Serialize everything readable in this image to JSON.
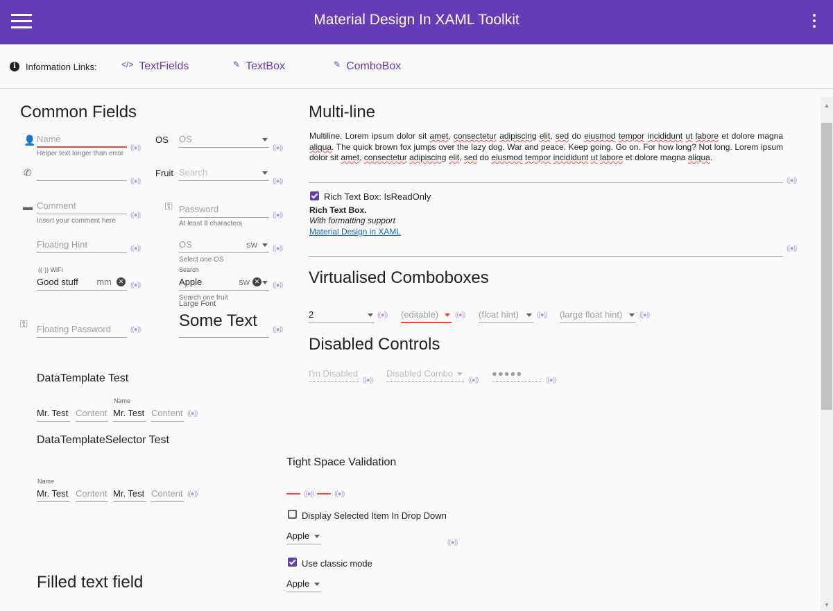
{
  "app": {
    "title": "Material Design In XAML Toolkit"
  },
  "info": {
    "label": "Information Links:",
    "links": [
      {
        "label": "TextFields",
        "icon": "code-icon"
      },
      {
        "label": "TextBox",
        "icon": "pencil-icon"
      },
      {
        "label": "ComboBox",
        "icon": "pencil-icon"
      }
    ]
  },
  "common": {
    "heading": "Common Fields",
    "name": {
      "hint": "Name",
      "helper": "Helper text longer than error"
    },
    "phone": {
      "hint": ""
    },
    "comment": {
      "hint": "Comment",
      "helper": "Insert your comment here"
    },
    "floating_hint": "Floating Hint",
    "wifi": {
      "label": "WiFi",
      "value": "Good stuff",
      "suffix": "mm"
    },
    "floating_password": "Floating Password",
    "os": {
      "label": "OS",
      "hint": "OS"
    },
    "fruit": {
      "label": "Fruit",
      "hint": "Search"
    },
    "password": {
      "hint": "Password",
      "helper": "At least 8 characters"
    },
    "os2": {
      "hint": "OS",
      "suffix": "sw",
      "helper": "Select one OS"
    },
    "search": {
      "label": "Search",
      "value": "Apple",
      "suffix": "sw",
      "helper": "Search one fruit"
    },
    "large_font": {
      "label": "Large Font",
      "value": "Some Text"
    }
  },
  "datatemplate": {
    "title": "DataTemplate Test",
    "name_label": "Name",
    "cells": [
      "Mr. Test",
      "Content",
      "Mr. Test",
      "Content"
    ]
  },
  "selector": {
    "title": "DataTemplateSelector Test",
    "name_label": "Name",
    "cells": [
      "Mr. Test",
      "Content",
      "Mr. Test",
      "Content"
    ]
  },
  "filled": {
    "heading": "Filled text field"
  },
  "multiline": {
    "heading": "Multi-line",
    "text_parts": [
      [
        "Multiline. Lorem ipsum dolor sit ",
        false
      ],
      [
        "amet",
        true
      ],
      [
        ", ",
        false
      ],
      [
        "consectetur",
        true
      ],
      [
        " ",
        false
      ],
      [
        "adipiscing",
        true
      ],
      [
        " ",
        false
      ],
      [
        "elit",
        true
      ],
      [
        ", ",
        false
      ],
      [
        "sed",
        true
      ],
      [
        " do ",
        false
      ],
      [
        "eiusmod",
        true
      ],
      [
        " ",
        false
      ],
      [
        "tempor",
        true
      ],
      [
        " ",
        false
      ],
      [
        "incididunt",
        true
      ],
      [
        " ",
        false
      ],
      [
        "ut",
        true
      ],
      [
        " ",
        false
      ],
      [
        "labore",
        true
      ],
      [
        " et dolore magna ",
        false
      ],
      [
        "aliqua",
        true
      ],
      [
        ". The quick brown fox jumps over the lazy dog. War and peace. Keep going. Go on. For how long? Not long. Lorem ipsum dolor sit ",
        false
      ],
      [
        "amet",
        true
      ],
      [
        ", ",
        false
      ],
      [
        "consectetur",
        true
      ],
      [
        " ",
        false
      ],
      [
        "adipiscing",
        true
      ],
      [
        " ",
        false
      ],
      [
        "elit",
        true
      ],
      [
        ", ",
        false
      ],
      [
        "sed",
        true
      ],
      [
        " do ",
        false
      ],
      [
        "eiusmod",
        true
      ],
      [
        " ",
        false
      ],
      [
        "tempor",
        true
      ],
      [
        " ",
        false
      ],
      [
        "incididunt",
        true
      ],
      [
        " ",
        false
      ],
      [
        "ut",
        true
      ],
      [
        " ",
        false
      ],
      [
        "labore",
        true
      ],
      [
        " et dolore magna ",
        false
      ],
      [
        "aliqua",
        true
      ],
      [
        ".",
        false
      ]
    ],
    "rtb_checkbox": "Rich Text Box: IsReadOnly",
    "rtb_bold": "Rich Text Box.",
    "rtb_italic": "With formatting support",
    "rtb_link": "Material Design in XAML"
  },
  "virtualised": {
    "heading": "Virtualised Comboboxes",
    "combo1": "2",
    "combo2": "(editable)",
    "combo3": "(float hint)",
    "combo4": "(large float hint)"
  },
  "disabled": {
    "heading": "Disabled Controls",
    "textbox": "I'm Disabled",
    "combo": "Disabled Combo",
    "password": "●●●●●"
  },
  "tight": {
    "title": "Tight Space Validation",
    "display_selected": "Display Selected Item In Drop Down",
    "combo_a": "Apple",
    "classic_mode": "Use classic mode",
    "combo_b": "Apple"
  },
  "colors": {
    "primary": "#673ab7",
    "error": "#f44336",
    "accent_light": "#b39ddb"
  }
}
